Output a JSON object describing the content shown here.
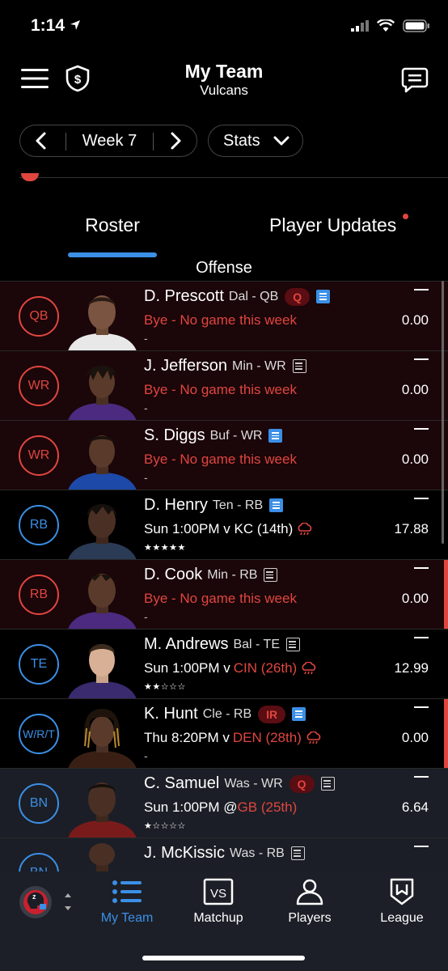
{
  "status_bar": {
    "time": "1:14"
  },
  "header": {
    "title": "My Team",
    "subtitle": "Vulcans"
  },
  "controls": {
    "week_label": "Week 7",
    "stats_label": "Stats"
  },
  "tabs": {
    "roster": "Roster",
    "player_updates": "Player Updates"
  },
  "section": {
    "offense": "Offense"
  },
  "players": [
    {
      "pos": "QB",
      "name": "D. Prescott",
      "meta": "Dal - QB",
      "badge": "Q",
      "game": "Bye - No game this week",
      "sub": "-",
      "proj": "—",
      "score": "0.00"
    },
    {
      "pos": "WR",
      "name": "J. Jefferson",
      "meta": "Min - WR",
      "game": "Bye - No game this week",
      "sub": "-",
      "proj": "—",
      "score": "0.00"
    },
    {
      "pos": "WR",
      "name": "S. Diggs",
      "meta": "Buf - WR",
      "game": "Bye - No game this week",
      "sub": "-",
      "proj": "—",
      "score": "0.00"
    },
    {
      "pos": "RB",
      "name": "D. Henry",
      "meta": "Ten - RB",
      "game": "Sun 1:00PM v KC (14th)",
      "stars": "★★★★★",
      "proj": "—",
      "score": "17.88"
    },
    {
      "pos": "RB",
      "name": "D. Cook",
      "meta": "Min - RB",
      "game": "Bye - No game this week",
      "sub": "-",
      "proj": "—",
      "score": "0.00"
    },
    {
      "pos": "TE",
      "name": "M. Andrews",
      "meta": "Bal - TE",
      "game_pre": "Sun 1:00PM v",
      "game_opp": "CIN (26th)",
      "stars": "★★☆☆☆",
      "proj": "—",
      "score": "12.99"
    },
    {
      "pos": "W/R/T",
      "name": "K. Hunt",
      "meta": "Cle - RB",
      "badge": "IR",
      "game_pre": "Thu 8:20PM v",
      "game_opp": "DEN (28th)",
      "sub": "-",
      "proj": "—",
      "score": "0.00"
    },
    {
      "pos": "BN",
      "name": "C. Samuel",
      "meta": "Was - WR",
      "badge": "Q",
      "game_pre": "Sun 1:00PM @",
      "game_opp": "GB (25th)",
      "stars": "★☆☆☆☆",
      "proj": "—",
      "score": "6.64"
    },
    {
      "pos": "BN",
      "name": "J. McKissic",
      "meta": "Was - RB",
      "proj": "—"
    }
  ],
  "tabbar": {
    "my_team": "My Team",
    "matchup": "Matchup",
    "players": "Players",
    "league": "League"
  },
  "colors": {
    "accent": "#3b8fe6",
    "alert": "#e0463f",
    "bye_bg": "#1b0609",
    "tabbar_bg": "#1c1f27"
  }
}
